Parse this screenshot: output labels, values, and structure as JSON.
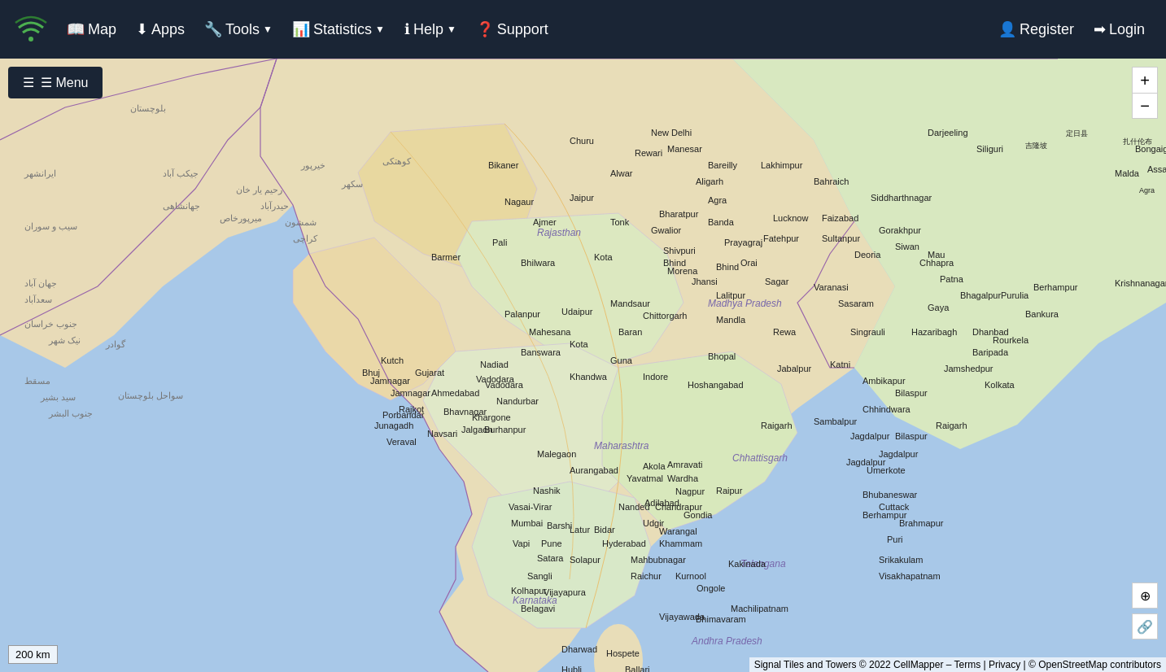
{
  "navbar": {
    "brand_icon": "signal-icon",
    "nav_items": [
      {
        "id": "map",
        "icon": "📖",
        "label": "Map",
        "has_dropdown": false
      },
      {
        "id": "apps",
        "icon": "⬇",
        "label": "Apps",
        "has_dropdown": false
      },
      {
        "id": "tools",
        "icon": "🔧",
        "label": "Tools",
        "has_dropdown": true
      },
      {
        "id": "statistics",
        "icon": "📊",
        "label": "Statistics",
        "has_dropdown": true
      },
      {
        "id": "help",
        "icon": "ℹ",
        "label": "Help",
        "has_dropdown": true
      },
      {
        "id": "support",
        "icon": "❓",
        "label": "Support",
        "has_dropdown": false
      }
    ],
    "right_items": [
      {
        "id": "register",
        "icon": "👤",
        "label": "Register"
      },
      {
        "id": "login",
        "icon": "➡",
        "label": "Login"
      }
    ]
  },
  "map": {
    "menu_label": "☰ Menu",
    "zoom_in": "+",
    "zoom_out": "−",
    "scale_label": "200 km",
    "attribution": "Signal Tiles and Towers © 2022 CellMapper – Terms | Privacy | © OpenStreetMap contributors",
    "locate_icon": "⊕",
    "link_icon": "🔗"
  }
}
